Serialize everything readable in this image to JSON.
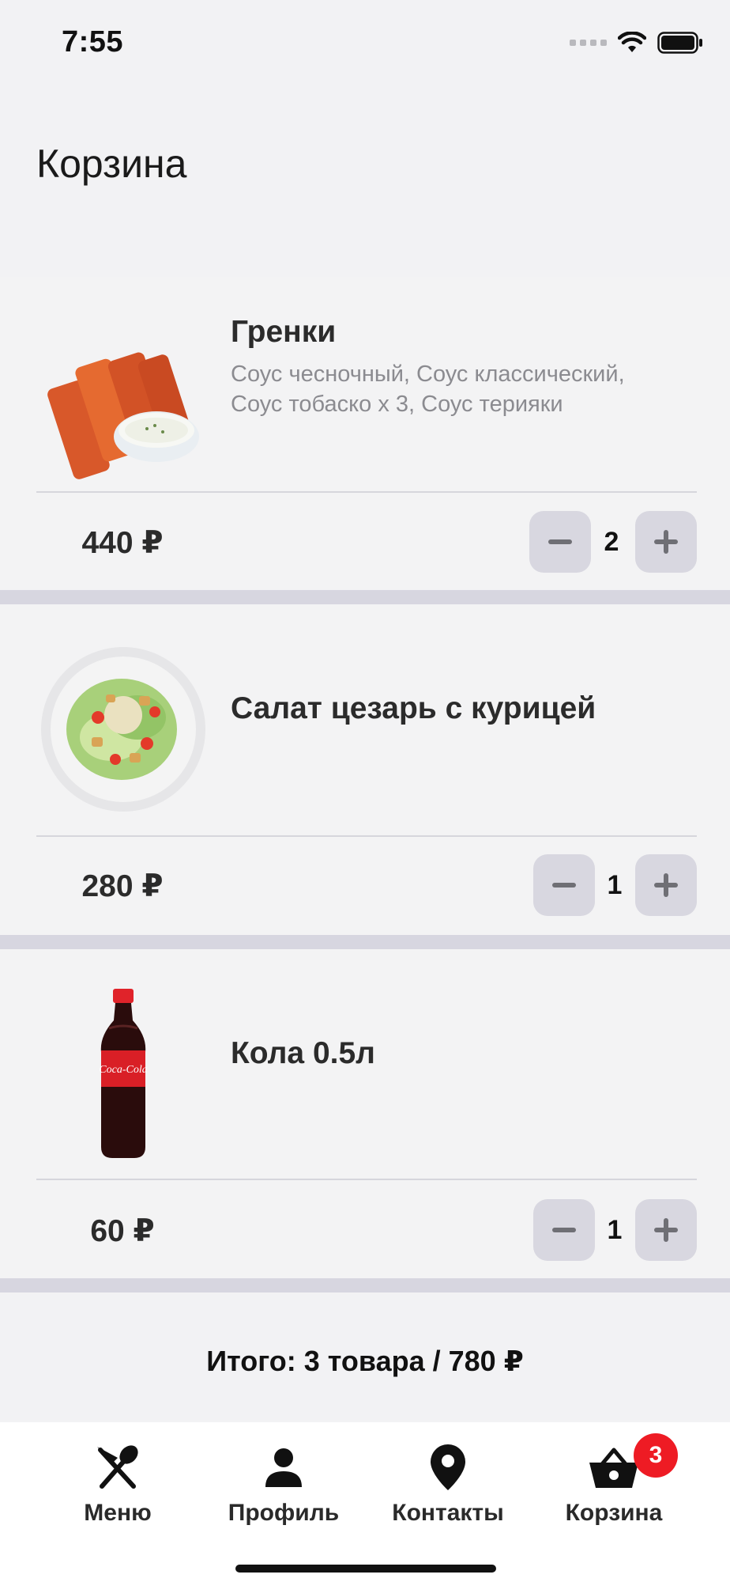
{
  "status": {
    "time": "7:55"
  },
  "page": {
    "title": "Корзина"
  },
  "items": [
    {
      "name": "Гренки",
      "description": "Соус чесночный, Соус классический, Соус тобаско х 3, Соус терияки",
      "price": "440 ₽",
      "quantity": "2",
      "image": "croutons-image"
    },
    {
      "name": "Салат цезарь с курицей",
      "description": "",
      "price": "280 ₽",
      "quantity": "1",
      "image": "caesar-salad-image"
    },
    {
      "name": "Кола 0.5л",
      "description": "",
      "price": "60 ₽",
      "quantity": "1",
      "image": "cola-bottle-image"
    }
  ],
  "summary": {
    "total": "Итого: 3 товара / 780 ₽"
  },
  "tabbar": {
    "tabs": [
      {
        "label": "Меню",
        "icon": "utensils-icon"
      },
      {
        "label": "Профиль",
        "icon": "person-icon"
      },
      {
        "label": "Контакты",
        "icon": "location-pin-icon"
      },
      {
        "label": "Корзина",
        "icon": "basket-icon"
      }
    ],
    "cart_badge": "3"
  },
  "colors": {
    "background": "#f2f2f4",
    "separator": "#d7d6e0",
    "button": "#d8d7e0",
    "badge": "#ee1b24"
  }
}
